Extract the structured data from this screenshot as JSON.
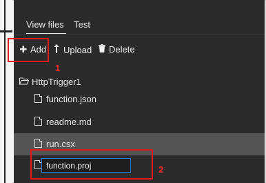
{
  "tabs": [
    {
      "label": "View files",
      "active": true
    },
    {
      "label": "Test",
      "active": false
    }
  ],
  "toolbar": {
    "add": {
      "icon": "plus-icon",
      "label": "Add"
    },
    "upload": {
      "icon": "upload-arrow-icon",
      "label": "Upload"
    },
    "delete": {
      "icon": "trash-icon",
      "label": "Delete"
    }
  },
  "tree": {
    "folder": {
      "icon": "folder-open-icon",
      "name": "HttpTrigger1"
    },
    "files": [
      {
        "name": "function.json",
        "selected": false
      },
      {
        "name": "readme.md",
        "selected": false
      },
      {
        "name": "run.csx",
        "selected": true
      }
    ],
    "new_file_value": "function.proj"
  },
  "annotations": {
    "step1": "1",
    "step2": "2",
    "color": "#e11b1b"
  },
  "theme": {
    "panel_bg": "#2b2b2b",
    "selected_bg": "#555555",
    "input_border": "#2f7bd0"
  }
}
